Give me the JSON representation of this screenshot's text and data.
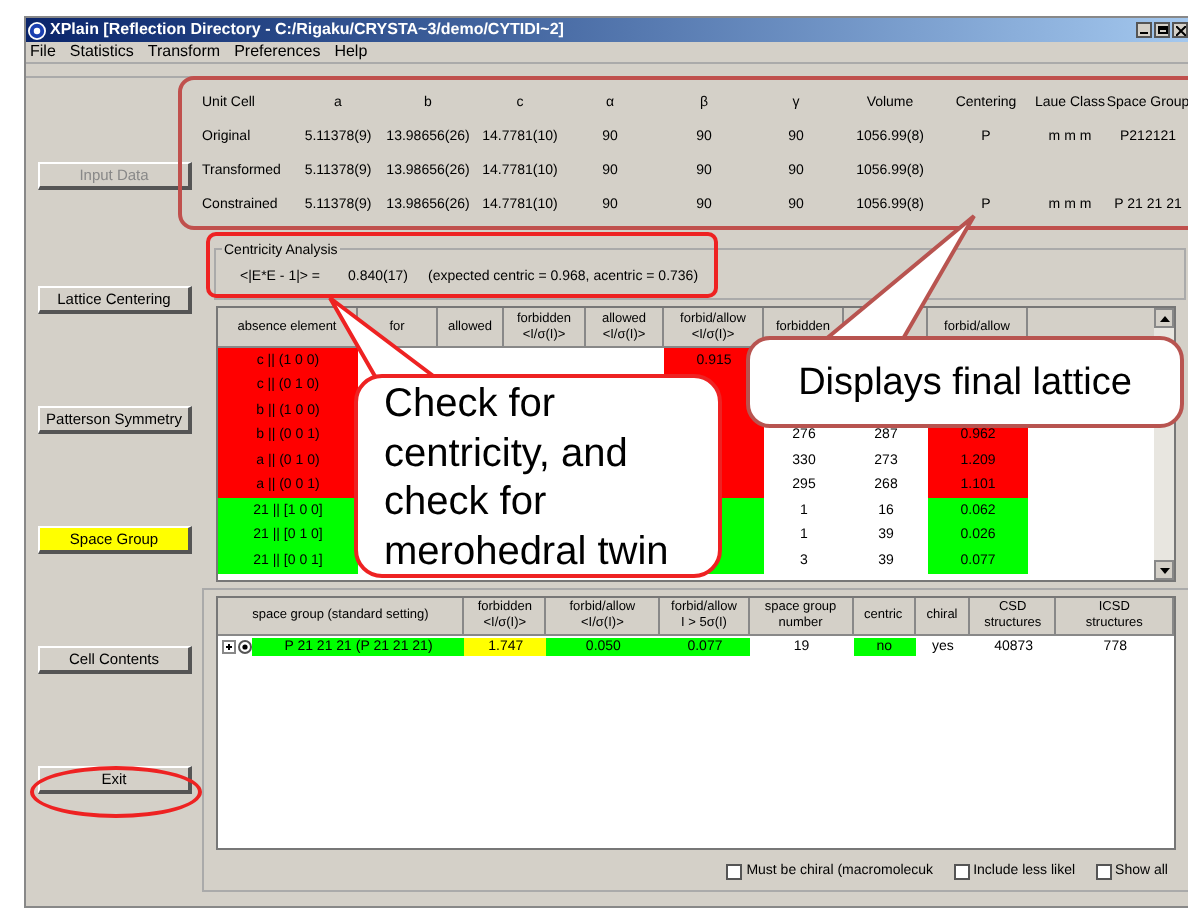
{
  "window": {
    "title": "XPlain [Reflection Directory - C:/Rigaku/CRYSTA~3/demo/CYTIDI~2]"
  },
  "menu": [
    {
      "label": "File"
    },
    {
      "label": "Statistics"
    },
    {
      "label": "Transform"
    },
    {
      "label": "Preferences"
    },
    {
      "label": "Help"
    }
  ],
  "side_buttons": [
    {
      "label": "Input Data",
      "disabled": true,
      "selected": false
    },
    {
      "label": "Lattice Centering",
      "disabled": false,
      "selected": false
    },
    {
      "label": "Patterson Symmetry",
      "disabled": false,
      "selected": false
    },
    {
      "label": "Space Group",
      "disabled": false,
      "selected": true
    },
    {
      "label": "Cell Contents",
      "disabled": false,
      "selected": false
    },
    {
      "label": "Exit",
      "disabled": false,
      "selected": false
    }
  ],
  "unit_cell": {
    "columns": [
      "Unit Cell",
      "a",
      "b",
      "c",
      "α",
      "β",
      "γ",
      "Volume",
      "Centering",
      "Laue Class",
      "Space Group"
    ],
    "rows": [
      {
        "cells": [
          "Original",
          "5.11378(9)",
          "13.98656(26)",
          "14.7781(10)",
          "90",
          "90",
          "90",
          "1056.99(8)",
          "P",
          "m m m",
          "P212121"
        ]
      },
      {
        "cells": [
          "Transformed",
          "5.11378(9)",
          "13.98656(26)",
          "14.7781(10)",
          "90",
          "90",
          "90",
          "1056.99(8)"
        ]
      },
      {
        "cells": [
          "Constrained",
          "5.11378(9)",
          "13.98656(26)",
          "14.7781(10)",
          "90",
          "90",
          "90",
          "1056.99(8)",
          "P",
          "m m m",
          "P 21 21 21"
        ]
      }
    ]
  },
  "centricity": {
    "title": "Centricity Analysis",
    "label": "<|E*E - 1|> =",
    "value": "0.840(17)",
    "expected": "(expected centric = 0.968, acentric = 0.736)"
  },
  "absence_table": {
    "columns": [
      "absence element",
      "for",
      "allowed",
      "forbidden\n<I/σ(I)>",
      "allowed\n<I/σ(I)>",
      "forbid/allow\n<I/σ(I)>",
      "forbidden",
      null,
      "forbid/allow"
    ],
    "rows": [
      {
        "color": "#ff0000",
        "cells": [
          "c || (1 0 0)",
          null,
          null,
          null,
          null,
          "0.915",
          null,
          null,
          null
        ]
      },
      {
        "color": "#ff0000",
        "cells": [
          "c || (0 1 0)",
          null,
          null,
          null,
          null,
          null,
          null,
          null,
          null
        ]
      },
      {
        "color": "#ff0000",
        "cells": [
          "b || (1 0 0)",
          null,
          null,
          null,
          null,
          null,
          null,
          null,
          null
        ]
      },
      {
        "color": "#ff0000",
        "cells": [
          "b || (0 0 1)",
          null,
          null,
          null,
          null,
          null,
          "276",
          "287",
          "0.962"
        ]
      },
      {
        "color": "#ff0000",
        "cells": [
          "a || (0 1 0)",
          null,
          null,
          null,
          null,
          null,
          "330",
          "273",
          "1.209"
        ]
      },
      {
        "color": "#ff0000",
        "cells": [
          "a || (0 0 1)",
          null,
          null,
          null,
          null,
          null,
          "295",
          "268",
          "1.101"
        ]
      },
      {
        "color": "#00ff00",
        "cells": [
          "21 || [1 0 0]",
          null,
          null,
          null,
          null,
          null,
          "1",
          "16",
          "0.062"
        ]
      },
      {
        "color": "#00ff00",
        "cells": [
          "21 || [0 1 0]",
          null,
          null,
          null,
          null,
          null,
          "1",
          "39",
          "0.026"
        ]
      },
      {
        "color": "#00ff00",
        "cells": [
          "21 || [0 0 1]",
          null,
          null,
          null,
          null,
          null,
          "3",
          "39",
          "0.077"
        ]
      }
    ]
  },
  "space_group_table": {
    "columns": [
      "space group (standard setting)",
      "forbidden\n<I/σ(I)>",
      "forbid/allow\n<I/σ(I)>",
      "forbid/allow\nI > 5σ(I)",
      "space group\nnumber",
      "centric",
      "chiral",
      "CSD\nstructures",
      "ICSD\nstructures"
    ],
    "rows": [
      {
        "selected": true,
        "expanded": false,
        "cells": [
          {
            "text": "P 21 21 21 (P 21 21 21)",
            "color": "#00ff00"
          },
          {
            "text": "1.747",
            "color": "#ffff00"
          },
          {
            "text": "0.050",
            "color": "#00ff00"
          },
          {
            "text": "0.077",
            "color": "#00ff00"
          },
          {
            "text": "19"
          },
          {
            "text": "no",
            "color": "#00ff00"
          },
          {
            "text": "yes"
          },
          {
            "text": "40873"
          },
          {
            "text": "778"
          }
        ]
      }
    ]
  },
  "options": [
    {
      "label": "Must be chiral (macromolecuk",
      "checked": false
    },
    {
      "label": "Include less likel",
      "checked": false
    },
    {
      "label": "Show all",
      "checked": false
    }
  ],
  "callouts": [
    {
      "text": "Check for centricity, and check for merohedral twin"
    },
    {
      "text": "Displays final lattice"
    }
  ]
}
